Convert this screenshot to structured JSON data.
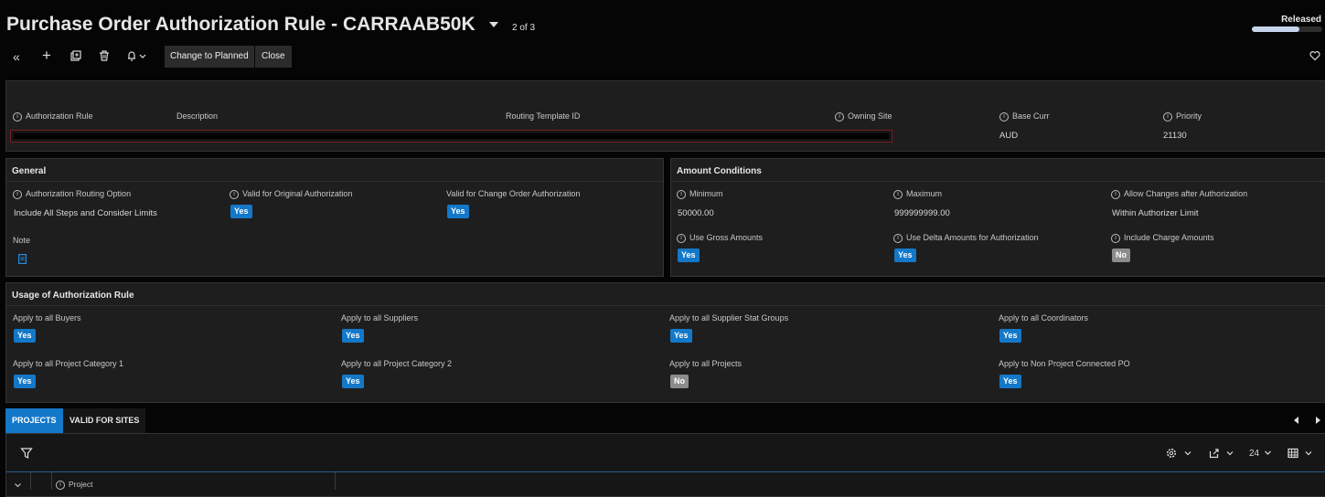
{
  "header": {
    "title": "Purchase Order Authorization Rule - CARRAAB50K",
    "pager": "2 of 3",
    "status": "Released",
    "status_progress": 0.68
  },
  "toolbar": {
    "icons": [
      "double-chevron-left-icon",
      "plus-icon",
      "duplicate-icon",
      "trash-icon",
      "bell-icon"
    ],
    "change_label": "Change to Planned",
    "close_label": "Close"
  },
  "record": {
    "labels": {
      "authorization_rule": "Authorization Rule",
      "description": "Description",
      "routing_template_id": "Routing Template ID",
      "owning_site": "Owning Site",
      "base_curr": "Base Curr",
      "priority": "Priority"
    },
    "values": {
      "base_curr": "AUD",
      "priority": "21130"
    }
  },
  "general": {
    "title": "General",
    "routing_option_label": "Authorization Routing Option",
    "routing_option_value": "Include All Steps and Consider Limits",
    "valid_original_label": "Valid for Original Authorization",
    "valid_original_value": "Yes",
    "valid_change_label": "Valid for Change Order Authorization",
    "valid_change_value": "Yes",
    "note_label": "Note"
  },
  "amount": {
    "title": "Amount Conditions",
    "minimum_label": "Minimum",
    "minimum_value": "50000.00",
    "maximum_label": "Maximum",
    "maximum_value": "999999999.00",
    "allow_changes_label": "Allow Changes after Authorization",
    "allow_changes_value": "Within Authorizer Limit",
    "gross_label": "Use Gross Amounts",
    "gross_value": "Yes",
    "delta_label": "Use Delta Amounts for Authorization",
    "delta_value": "Yes",
    "charge_label": "Include Charge Amounts",
    "charge_value": "No"
  },
  "usage": {
    "title": "Usage of Authorization Rule",
    "items": [
      {
        "label": "Apply to all Buyers",
        "value": "Yes"
      },
      {
        "label": "Apply to all Suppliers",
        "value": "Yes"
      },
      {
        "label": "Apply to all Supplier Stat Groups",
        "value": "Yes"
      },
      {
        "label": "Apply to all Coordinators",
        "value": "Yes"
      },
      {
        "label": "Apply to all Project Category 1",
        "value": "Yes"
      },
      {
        "label": "Apply to all Project Category 2",
        "value": "Yes"
      },
      {
        "label": "Apply to all Projects",
        "value": "No"
      },
      {
        "label": "Apply to Non Project Connected PO",
        "value": "Yes"
      }
    ]
  },
  "tabs": [
    {
      "label": "PROJECTS",
      "active": true
    },
    {
      "label": "VALID FOR SITES",
      "active": false
    }
  ],
  "grid": {
    "page_size": "24",
    "column_project": "Project"
  }
}
